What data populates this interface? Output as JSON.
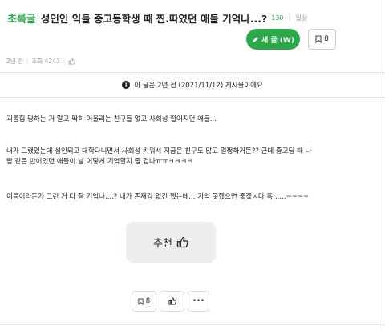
{
  "post": {
    "board_name": "초록글",
    "title": "성인인 익들 중고등학생 때 찐.따였던 애들 기억나...?",
    "comment_count": "130",
    "category": "일상",
    "time_ago": "2년 전",
    "views": "조회 4243"
  },
  "toolbar": {
    "write_label": "새 글 (W)",
    "bookmark_count": "8"
  },
  "notice": {
    "text": "이 글은 2년 전 (2021/11/12) 게시물이에요"
  },
  "body": {
    "paragraphs": [
      "괴롭힘 당하는 거 말고 딱히 어울리는 친구들 없고 사회성 떨어지던 애들...",
      "내가 그랬었는데 성인되고 대학다니면서 사회성 키워서 지금은 친구도 많고 멀쩡하거든?? 근데 중고딩 때 나",
      "랑 같은 반이었던 애들이 날 어떻게 기억할지 좀 겁나ㅠㅠㅋㅋㅋㅋ",
      "이름이라든가 그런 거 다 잘 기억나....? 내가 존재감 없긴 했는데... 기억 못했으면 좋겠ㅅ다 흑......~~~~"
    ]
  },
  "actions": {
    "recommend_label": "추천",
    "bookmark_count": "8",
    "more_label": "•••"
  },
  "colors": {
    "accent": "#2aa84a",
    "button_gray": "#eceeef"
  }
}
